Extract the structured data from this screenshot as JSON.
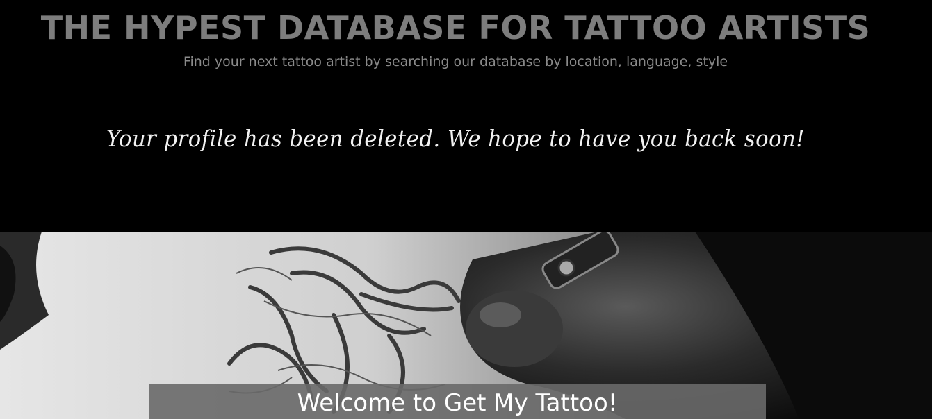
{
  "header": {
    "title": "THE HYPEST DATABASE FOR TATTOO ARTISTS",
    "tagline": "Find your next tattoo artist by searching our database by location, language, style"
  },
  "notice": {
    "message": "Your profile has been deleted. We hope to have you back soon!"
  },
  "hero": {
    "image_subject": "tattoo-artist-gloved-hand-tattooing-skin",
    "welcome": "Welcome to Get My Tattoo!"
  },
  "colors": {
    "background": "#000000",
    "title": "#7d7d7d",
    "tagline": "#8a8a8a",
    "notice": "#f2f2f2",
    "welcome_band": "#696969"
  }
}
